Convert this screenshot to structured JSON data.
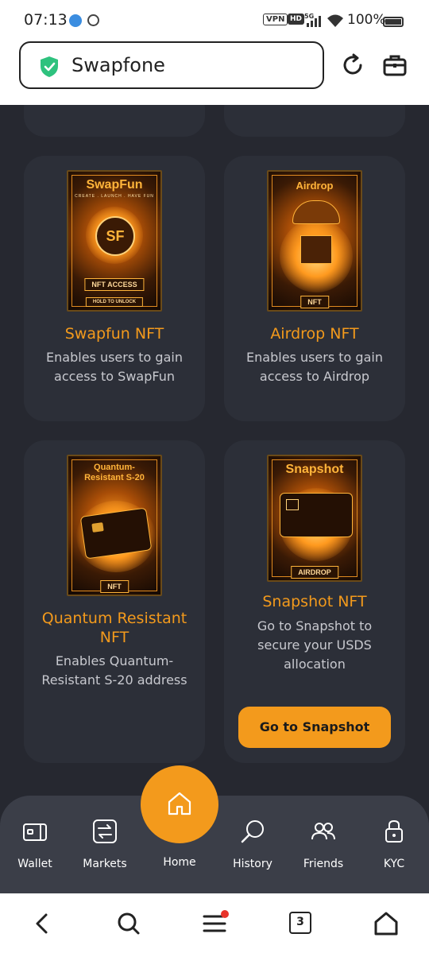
{
  "status_bar": {
    "time": "07:13",
    "vpn": "VPN",
    "hd": "HD",
    "battery": "100%"
  },
  "browser": {
    "url": "Swapfone"
  },
  "cards": [
    {
      "poster_title": "SwapFun",
      "poster_sub": "CREATE . LAUNCH . HAVE FUN",
      "poster_tag": "NFT ACCESS",
      "poster_tag2": "HOLD TO UNLOCK",
      "title": "Swapfun NFT",
      "description": "Enables users to gain access to SwapFun"
    },
    {
      "poster_title": "Airdrop",
      "poster_tag": "NFT",
      "title": "Airdrop NFT",
      "description": "Enables users to gain access to Airdrop"
    },
    {
      "poster_title": "Quantum-Resistant S-20",
      "poster_tag": "NFT",
      "title": "Quantum Resistant NFT",
      "description": "Enables Quantum-Resistant S-20 address"
    },
    {
      "poster_title": "Snapshot",
      "poster_tag": "AIRDROP",
      "title": "Snapshot NFT",
      "description": "Go to Snapshot to secure your USDS allocation",
      "button": "Go to Snapshot"
    }
  ],
  "nav": {
    "wallet": "Wallet",
    "markets": "Markets",
    "home": "Home",
    "history": "History",
    "friends": "Friends",
    "kyc": "KYC"
  },
  "system_nav": {
    "tab_count": "3"
  },
  "colors": {
    "accent": "#f39a1c",
    "background": "#262830",
    "card": "#2c2f38",
    "navbar": "#3b3e48"
  }
}
